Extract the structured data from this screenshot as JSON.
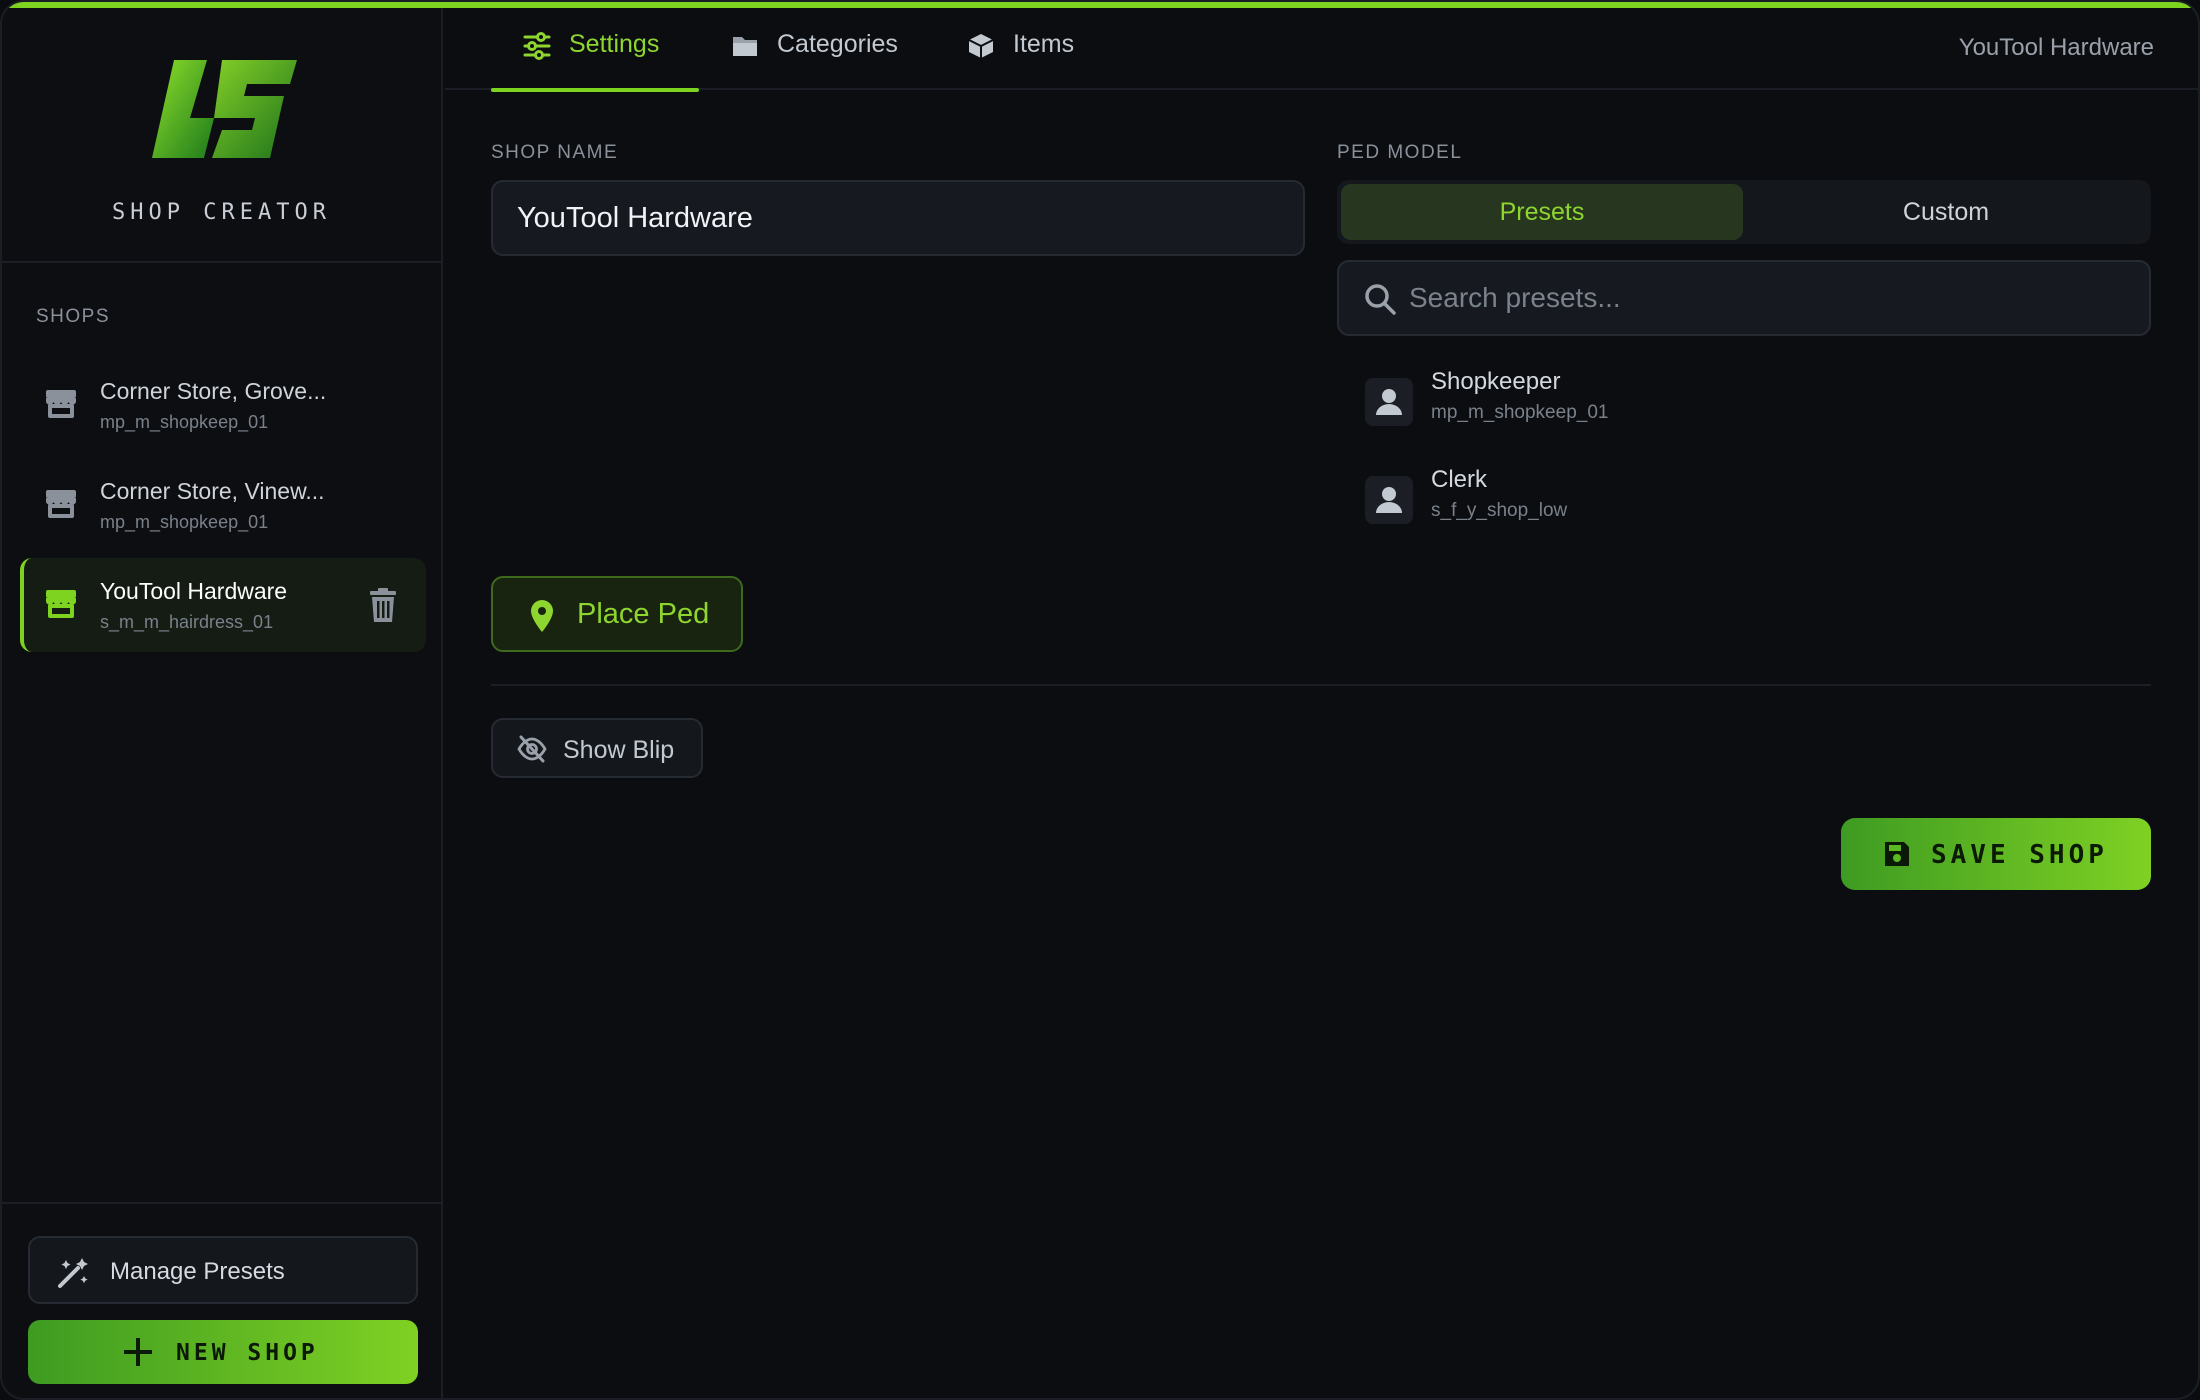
{
  "colors": {
    "accent": "#7ed321",
    "background": "#0b0d10",
    "panel": "#161a20",
    "text_muted": "#8a919b"
  },
  "brand": {
    "title": "SHOP CREATOR",
    "logo_icon": "lightning-logo-icon"
  },
  "sidebar": {
    "section_label": "SHOPS",
    "shops": [
      {
        "name": "Corner Store, Grove...",
        "model": "mp_m_shopkeep_01",
        "icon": "store-icon",
        "active": false
      },
      {
        "name": "Corner Store, Vinew...",
        "model": "mp_m_shopkeep_01",
        "icon": "store-icon",
        "active": false
      },
      {
        "name": "YouTool Hardware",
        "model": "s_m_m_hairdress_01",
        "icon": "store-icon",
        "active": true
      }
    ],
    "manage_presets_label": "Manage Presets",
    "new_shop_label": "NEW SHOP"
  },
  "tabs": [
    {
      "label": "Settings",
      "icon": "sliders-icon",
      "active": true
    },
    {
      "label": "Categories",
      "icon": "folder-icon",
      "active": false
    },
    {
      "label": "Items",
      "icon": "box-icon",
      "active": false
    }
  ],
  "header": {
    "current_shop": "YouTool Hardware"
  },
  "settings": {
    "shop_name_label": "SHOP NAME",
    "shop_name_value": "YouTool Hardware",
    "ped_model_label": "PED MODEL",
    "ped_modes": [
      {
        "label": "Presets",
        "active": true
      },
      {
        "label": "Custom",
        "active": false
      }
    ],
    "search_placeholder": "Search presets...",
    "presets": [
      {
        "name": "Shopkeeper",
        "model": "mp_m_shopkeep_01",
        "icon": "person-icon"
      },
      {
        "name": "Clerk",
        "model": "s_f_y_shop_low",
        "icon": "person-icon"
      }
    ],
    "place_ped_label": "Place Ped",
    "show_blip_label": "Show Blip",
    "save_label": "SAVE SHOP"
  }
}
